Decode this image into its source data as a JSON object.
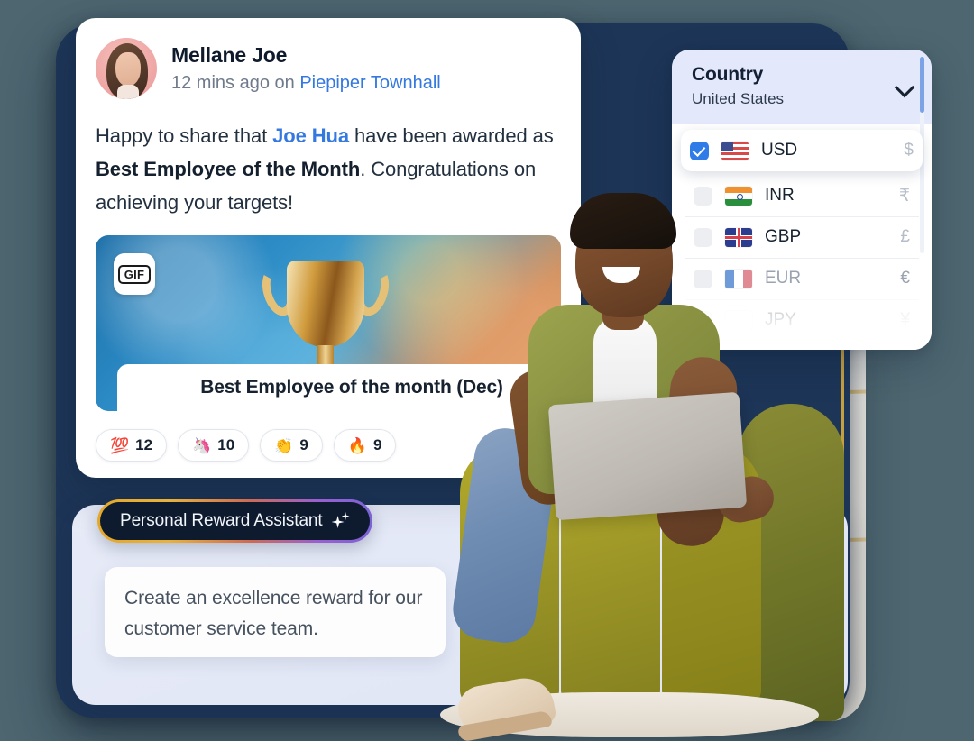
{
  "post": {
    "author": "Mellane Joe",
    "meta_prefix": "12 mins ago on ",
    "channel": "Piepiper Townhall",
    "body_part1": "Happy to share that ",
    "body_mention": "Joe Hua",
    "body_part2": " have been awarded as ",
    "body_bold": "Best Employee of the Month",
    "body_part3": ". Congratulations on achieving your targets!",
    "gif_badge_label": "GIF",
    "media_caption": "Best Employee of the month (Dec)",
    "reactions": [
      {
        "emoji": "💯",
        "name": "hundred-points-reaction",
        "count": "12"
      },
      {
        "emoji": "🦄",
        "name": "unicorn-reaction",
        "count": "10"
      },
      {
        "emoji": "👏",
        "name": "clap-reaction",
        "count": "9"
      },
      {
        "emoji": "🔥",
        "name": "fire-reaction",
        "count": "9"
      }
    ]
  },
  "currency_card": {
    "country_label": "Country",
    "country_value": "United States",
    "chevron_icon": "chevron-down-icon",
    "rows": [
      {
        "code": "USD",
        "symbol": "$",
        "flag": "us",
        "checked": true,
        "state": "selected"
      },
      {
        "code": "INR",
        "symbol": "₹",
        "flag": "in",
        "checked": false,
        "state": "normal"
      },
      {
        "code": "GBP",
        "symbol": "£",
        "flag": "gb",
        "checked": false,
        "state": "normal"
      },
      {
        "code": "EUR",
        "symbol": "€",
        "flag": "eu",
        "checked": false,
        "state": "dim"
      },
      {
        "code": "JPY",
        "symbol": "¥",
        "flag": "jp",
        "checked": false,
        "state": "fade"
      }
    ]
  },
  "assistant": {
    "pill_label": "Personal Reward Assistant",
    "sparkle_icon": "sparkle-icon",
    "prompt_text": "Create an excellence reward for our customer service team."
  },
  "colors": {
    "page_background": "#4d6670",
    "frame_navy": "#1d3557",
    "panel_lavender": "#e3e9fa",
    "accent_blue": "#3479e0",
    "checkbox_blue": "#2f7ce8",
    "gold_stripe": "#d9ab3e",
    "chair_olive": "#8a9242",
    "assistant_dark": "#0e1a2e"
  }
}
